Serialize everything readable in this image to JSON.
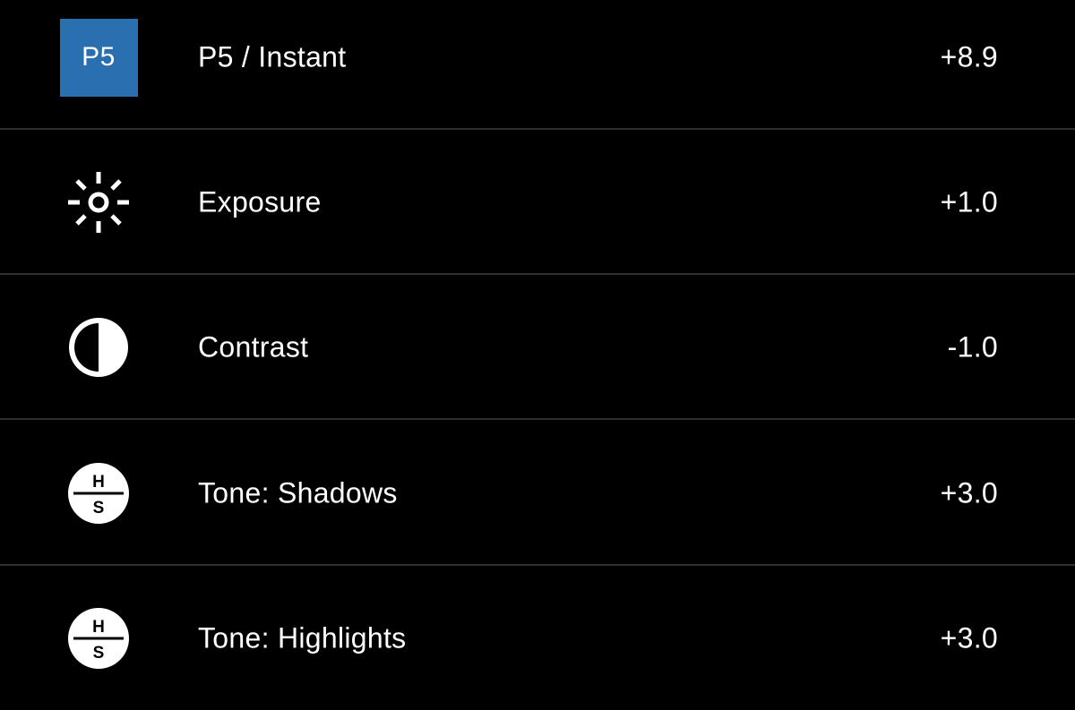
{
  "accent_color": "#2a6fb0",
  "rows": [
    {
      "icon": "preset-badge",
      "badge_text": "P5",
      "label": "P5 / Instant",
      "value": "+8.9"
    },
    {
      "icon": "sun-icon",
      "label": "Exposure",
      "value": "+1.0"
    },
    {
      "icon": "contrast-icon",
      "label": "Contrast",
      "value": "-1.0"
    },
    {
      "icon": "tone-hs-icon",
      "icon_text_top": "H",
      "icon_text_bottom": "S",
      "label": "Tone: Shadows",
      "value": "+3.0"
    },
    {
      "icon": "tone-hs-icon",
      "icon_text_top": "H",
      "icon_text_bottom": "S",
      "label": "Tone: Highlights",
      "value": "+3.0"
    }
  ]
}
